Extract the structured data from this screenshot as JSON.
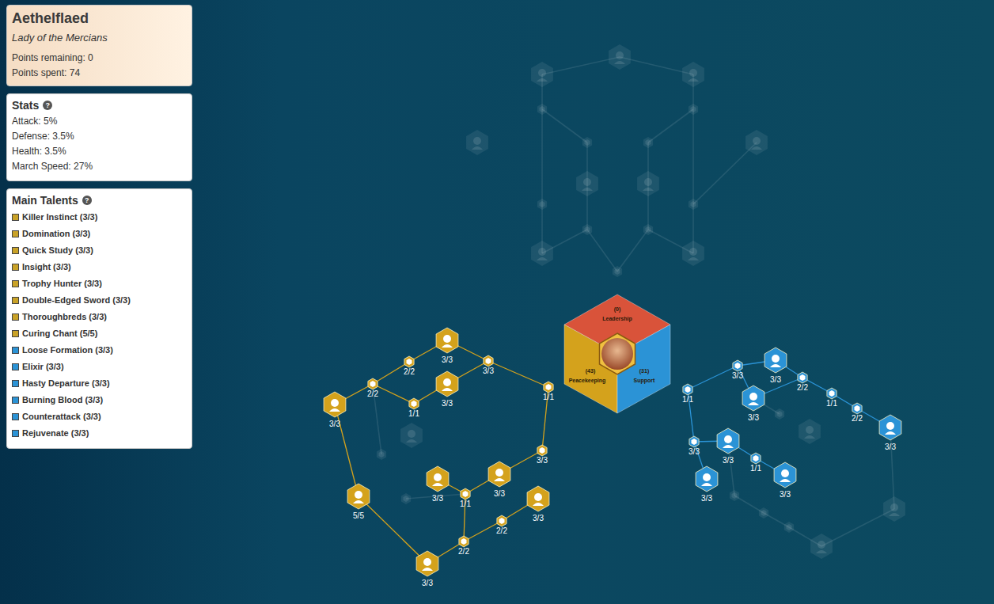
{
  "hero": {
    "name": "Aethelflaed",
    "title": "Lady of the Mercians",
    "points_remaining": "Points remaining: 0",
    "points_spent": "Points spent: 74"
  },
  "stats": {
    "title": "Stats",
    "help": "?",
    "items": [
      "Attack: 5%",
      "Defense: 3.5%",
      "Health: 3.5%",
      "March Speed: 27%"
    ]
  },
  "main_talents": {
    "title": "Main Talents",
    "help": "?",
    "items": [
      {
        "name": "Killer Instinct (3/3)",
        "color": "#c9a227"
      },
      {
        "name": "Domination (3/3)",
        "color": "#c9a227"
      },
      {
        "name": "Quick Study (3/3)",
        "color": "#c9a227"
      },
      {
        "name": "Insight (3/3)",
        "color": "#c9a227"
      },
      {
        "name": "Trophy Hunter (3/3)",
        "color": "#c9a227"
      },
      {
        "name": "Double-Edged Sword (3/3)",
        "color": "#c9a227"
      },
      {
        "name": "Thoroughbreds (3/3)",
        "color": "#c9a227"
      },
      {
        "name": "Curing Chant (5/5)",
        "color": "#c9a227"
      },
      {
        "name": "Loose Formation (3/3)",
        "color": "#2b93d6"
      },
      {
        "name": "Elixir (3/3)",
        "color": "#2b93d6"
      },
      {
        "name": "Hasty Departure (3/3)",
        "color": "#2b93d6"
      },
      {
        "name": "Burning Blood (3/3)",
        "color": "#2b93d6"
      },
      {
        "name": "Counterattack (3/3)",
        "color": "#2b93d6"
      },
      {
        "name": "Rejuvenate (3/3)",
        "color": "#2b93d6"
      }
    ]
  },
  "trees": [
    {
      "name": "Leadership",
      "points": "(0)",
      "color": "#d9533a",
      "nodes": [
        {
          "kind": "big",
          "label": "",
          "active": false
        },
        {
          "kind": "big",
          "label": "",
          "active": false
        },
        {
          "kind": "big",
          "label": "",
          "active": false
        },
        {
          "kind": "big",
          "label": "",
          "active": false
        },
        {
          "kind": "big",
          "label": "",
          "active": false
        },
        {
          "kind": "big",
          "label": "",
          "active": false
        },
        {
          "kind": "big",
          "label": "",
          "active": false
        },
        {
          "kind": "big",
          "label": "",
          "active": false
        },
        {
          "kind": "big",
          "label": "",
          "active": false
        },
        {
          "kind": "small",
          "label": "",
          "active": false
        },
        {
          "kind": "small",
          "label": "",
          "active": false
        },
        {
          "kind": "small",
          "label": "",
          "active": false
        },
        {
          "kind": "small",
          "label": "",
          "active": false
        },
        {
          "kind": "small",
          "label": "",
          "active": false
        },
        {
          "kind": "small",
          "label": "",
          "active": false
        },
        {
          "kind": "small",
          "label": "",
          "active": false
        },
        {
          "kind": "small",
          "label": "",
          "active": false
        },
        {
          "kind": "small",
          "label": "",
          "active": false
        }
      ]
    },
    {
      "name": "Peacekeeping",
      "points": "(43)",
      "color": "#d4a21c",
      "nodes": [
        {
          "kind": "big",
          "label": "3/3",
          "active": true
        },
        {
          "kind": "big",
          "label": "3/3",
          "active": true
        },
        {
          "kind": "big",
          "label": "3/3",
          "active": true
        },
        {
          "kind": "big",
          "label": "5/5",
          "active": true
        },
        {
          "kind": "big",
          "label": "3/3",
          "active": true
        },
        {
          "kind": "big",
          "label": "3/3",
          "active": true
        },
        {
          "kind": "big",
          "label": "3/3",
          "active": true
        },
        {
          "kind": "big",
          "label": "3/3",
          "active": true
        },
        {
          "kind": "big",
          "label": "",
          "active": false
        },
        {
          "kind": "small",
          "label": "2/2",
          "active": true
        },
        {
          "kind": "small",
          "label": "2/2",
          "active": true
        },
        {
          "kind": "small",
          "label": "1/1",
          "active": true
        },
        {
          "kind": "small",
          "label": "3/3",
          "active": true
        },
        {
          "kind": "small",
          "label": "1/1",
          "active": true
        },
        {
          "kind": "small",
          "label": "3/3",
          "active": true
        },
        {
          "kind": "small",
          "label": "1/1",
          "active": true
        },
        {
          "kind": "small",
          "label": "2/2",
          "active": true
        },
        {
          "kind": "small",
          "label": "2/2",
          "active": true
        },
        {
          "kind": "small",
          "label": "",
          "active": false
        },
        {
          "kind": "small",
          "label": "",
          "active": false
        }
      ]
    },
    {
      "name": "Support",
      "points": "(31)",
      "color": "#2b93d6",
      "nodes": [
        {
          "kind": "big",
          "label": "3/3",
          "active": true
        },
        {
          "kind": "big",
          "label": "3/3",
          "active": true
        },
        {
          "kind": "big",
          "label": "3/3",
          "active": true
        },
        {
          "kind": "big",
          "label": "3/3",
          "active": true
        },
        {
          "kind": "big",
          "label": "3/3",
          "active": true
        },
        {
          "kind": "big",
          "label": "3/3",
          "active": true
        },
        {
          "kind": "big",
          "label": "",
          "active": false
        },
        {
          "kind": "big",
          "label": "",
          "active": false
        },
        {
          "kind": "big",
          "label": "",
          "active": false
        },
        {
          "kind": "small",
          "label": "3/3",
          "active": true
        },
        {
          "kind": "small",
          "label": "2/2",
          "active": true
        },
        {
          "kind": "small",
          "label": "1/1",
          "active": true
        },
        {
          "kind": "small",
          "label": "2/2",
          "active": true
        },
        {
          "kind": "small",
          "label": "1/1",
          "active": true
        },
        {
          "kind": "small",
          "label": "3/3",
          "active": true
        },
        {
          "kind": "small",
          "label": "1/1",
          "active": true
        },
        {
          "kind": "small",
          "label": "",
          "active": false
        },
        {
          "kind": "small",
          "label": "",
          "active": false
        },
        {
          "kind": "small",
          "label": "",
          "active": false
        },
        {
          "kind": "small",
          "label": "",
          "active": false
        }
      ]
    }
  ]
}
